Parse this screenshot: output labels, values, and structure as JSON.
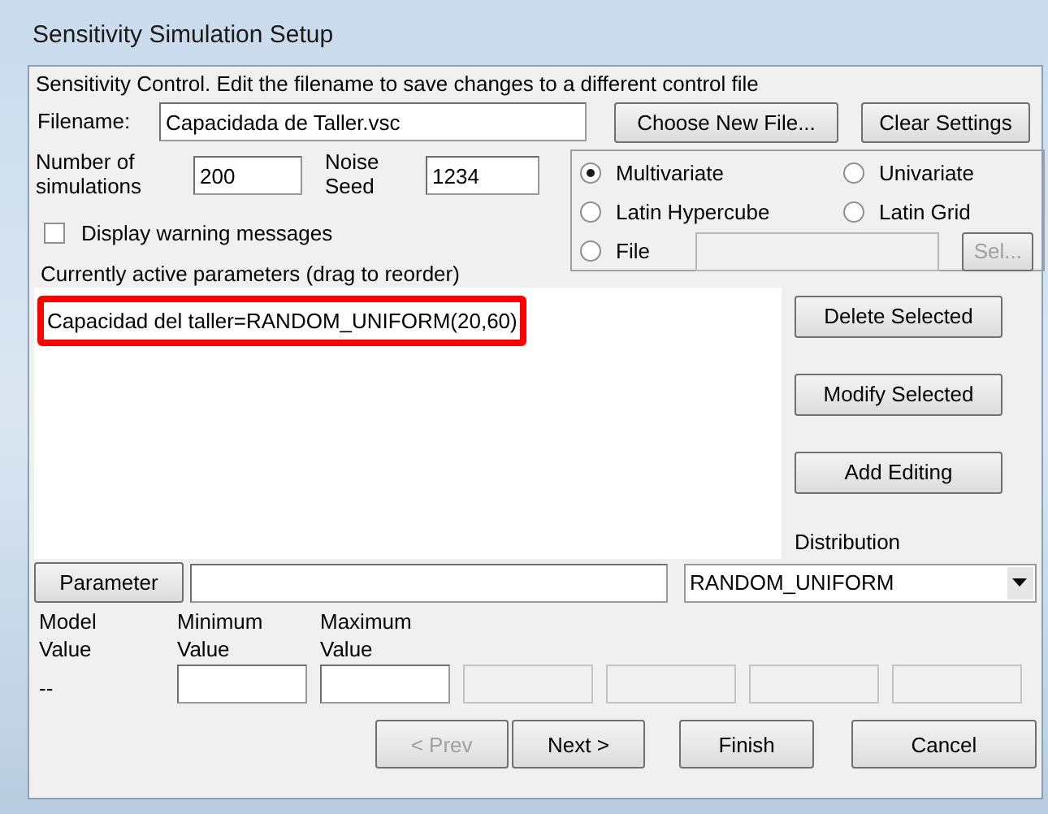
{
  "window": {
    "title": "Sensitivity Simulation Setup"
  },
  "intro": "Sensitivity Control.  Edit the filename to save changes to a different control file",
  "filename": {
    "label": "Filename:",
    "value": "Capacidada de Taller.vsc"
  },
  "file_buttons": [
    "Choose New File...",
    "Clear Settings"
  ],
  "simulations": {
    "label": "Number of simulations",
    "value": "200"
  },
  "noise_seed": {
    "label": "Noise Seed",
    "value": "1234"
  },
  "warning_checkbox": {
    "label": "Display warning messages",
    "checked": false
  },
  "methods": [
    {
      "label": "Multivariate",
      "selected": true
    },
    {
      "label": "Univariate",
      "selected": false
    },
    {
      "label": "Latin Hypercube",
      "selected": false
    },
    {
      "label": "Latin Grid",
      "selected": false
    },
    {
      "label": "File",
      "selected": false
    }
  ],
  "sel_button": {
    "label": "Sel...",
    "disabled": true
  },
  "parameters": {
    "label": "Currently active parameters (drag to reorder)",
    "items": [
      {
        "text": "Capacidad del taller=RANDOM_UNIFORM(20,60)",
        "annotated": true
      }
    ]
  },
  "list_buttons": [
    "Delete Selected",
    "Modify Selected",
    "Add Editing"
  ],
  "distribution": {
    "label": "Distribution",
    "value": "RANDOM_UNIFORM"
  },
  "parameter_button": "Parameter",
  "model_value": {
    "label": "Model Value",
    "value": "--"
  },
  "value_fields": [
    {
      "label": "Minimum Value",
      "disabled": false
    },
    {
      "label": "Maximum Value",
      "disabled": false
    },
    {
      "disabled": true
    },
    {
      "disabled": true
    },
    {
      "disabled": true
    },
    {
      "disabled": true
    }
  ],
  "nav_buttons": [
    {
      "label": "< Prev",
      "disabled": true
    },
    {
      "label": "Next >",
      "disabled": false
    },
    {
      "label": "Finish",
      "disabled": false
    },
    {
      "label": "Cancel",
      "disabled": false
    }
  ]
}
